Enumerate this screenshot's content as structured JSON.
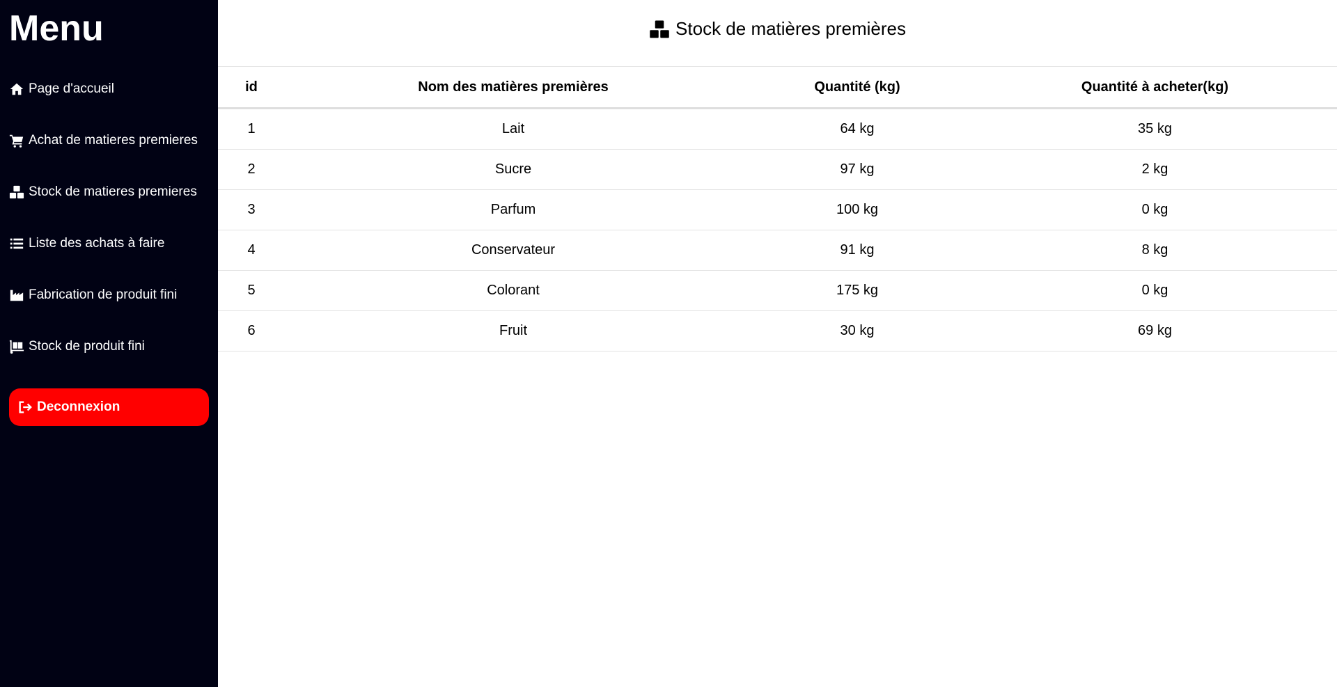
{
  "sidebar": {
    "title": "Menu",
    "items": [
      {
        "label": "Page d'accueil",
        "icon": "home-icon"
      },
      {
        "label": "Achat de matieres premieres",
        "icon": "cart-icon"
      },
      {
        "label": "Stock de matieres premieres",
        "icon": "boxes-icon"
      },
      {
        "label": "Liste des achats à faire",
        "icon": "list-icon"
      },
      {
        "label": "Fabrication de produit fini",
        "icon": "factory-icon"
      },
      {
        "label": "Stock de produit fini",
        "icon": "dolly-icon"
      }
    ],
    "logout_label": "Deconnexion",
    "logout_color": "#ff0000",
    "background": "#010214"
  },
  "main": {
    "title": "Stock de matières premières",
    "table": {
      "headers": [
        "id",
        "Nom des matières premières",
        "Quantité (kg)",
        "Quantité à acheter(kg)"
      ],
      "rows": [
        [
          "1",
          "Lait",
          "64 kg",
          "35 kg"
        ],
        [
          "2",
          "Sucre",
          "97 kg",
          "2 kg"
        ],
        [
          "3",
          "Parfum",
          "100 kg",
          "0 kg"
        ],
        [
          "4",
          "Conservateur",
          "91 kg",
          "8 kg"
        ],
        [
          "5",
          "Colorant",
          "175 kg",
          "0 kg"
        ],
        [
          "6",
          "Fruit",
          "30 kg",
          "69 kg"
        ]
      ]
    }
  }
}
